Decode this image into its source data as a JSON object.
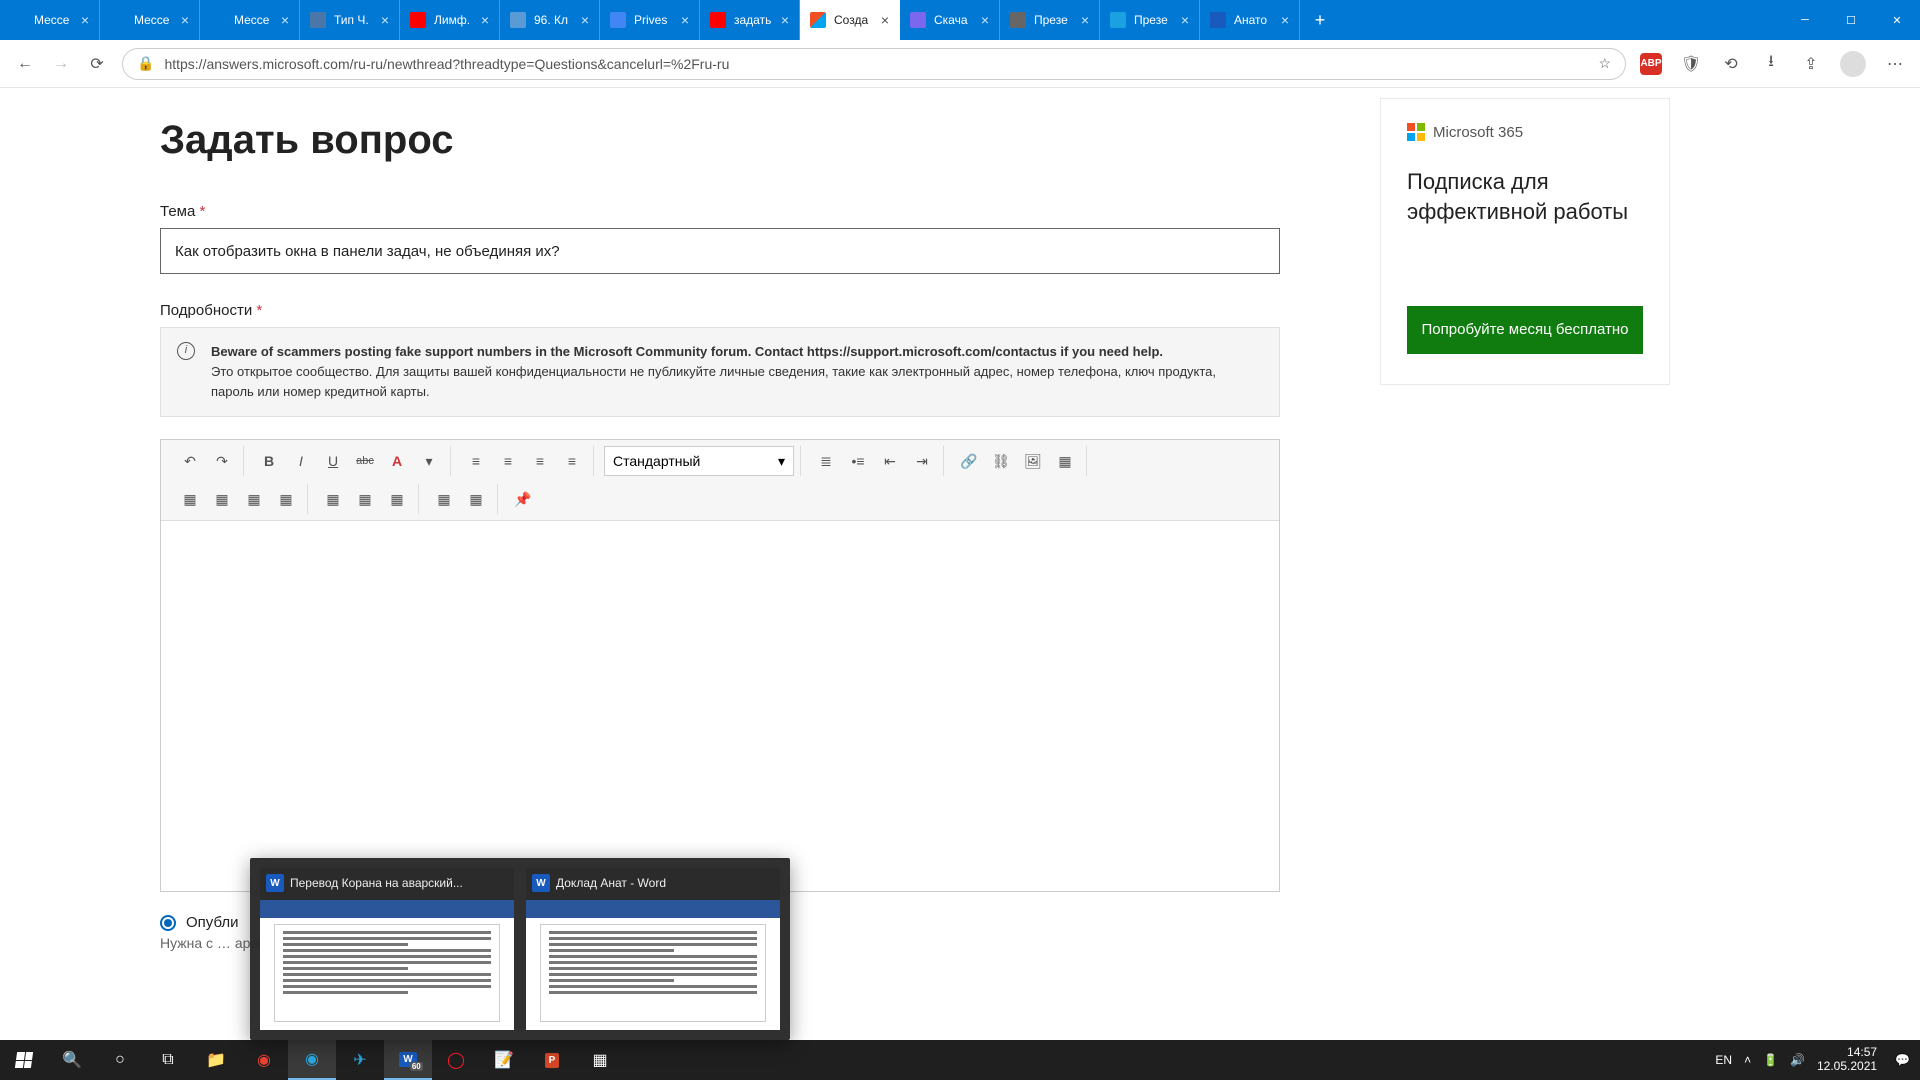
{
  "browser": {
    "tabs": [
      {
        "title": "Мессе",
        "favColor": "#0078d4"
      },
      {
        "title": "Мессе",
        "favColor": "#0078d4"
      },
      {
        "title": "Мессе",
        "favColor": "#0078d4"
      },
      {
        "title": "Тип Ч.",
        "favColor": "#4a76a8"
      },
      {
        "title": "Лимф.",
        "favColor": "#ff0000"
      },
      {
        "title": "96. Кл",
        "favColor": "#5b9bd5"
      },
      {
        "title": "Prives",
        "favColor": "#4285f4"
      },
      {
        "title": "задать",
        "favColor": "#ff0000"
      },
      {
        "title": "Созда",
        "favColor": "#00a4ef",
        "active": true
      },
      {
        "title": "Скача",
        "favColor": "#7b68ee"
      },
      {
        "title": "Презе",
        "favColor": "#666"
      },
      {
        "title": "Презе",
        "favColor": "#1ba1e2"
      },
      {
        "title": "Анато",
        "favColor": "#185abd"
      }
    ],
    "url": "https://answers.microsoft.com/ru-ru/newthread?threadtype=Questions&cancelurl=%2Fru-ru",
    "abp": "ABP"
  },
  "page": {
    "heading": "Задать вопрос",
    "subject_label": "Тема",
    "subject_value": "Как отобразить окна в панели задач, не объединяя их?",
    "details_label": "Подробности",
    "notice_bold": "Beware of scammers posting fake support numbers in the Microsoft Community forum. Contact https://support.microsoft.com/contactus if you need help.",
    "notice_text": "Это открытое сообщество. Для защиты вашей конфиденциальности не публикуйте личные сведения, такие как электронный адрес, номер телефона, ключ продукта, пароль или номер кредитной карты.",
    "style_select": "Стандартный",
    "publish_label": "Опубли",
    "hint_prefix": "Нужна с",
    "hint_suffix": "араметр, чтобы задать вопрос сообществу."
  },
  "promo": {
    "brand": "Microsoft 365",
    "headline": "Подписка для эффективной работы",
    "cta": "Попробуйте месяц бесплатно"
  },
  "word_thumbs": [
    {
      "title": "Перевод Корана на аварский..."
    },
    {
      "title": "Доклад Анат - Word"
    }
  ],
  "taskbar": {
    "lang": "EN",
    "time": "14:57",
    "date": "12.05.2021",
    "word_badge": "60"
  }
}
